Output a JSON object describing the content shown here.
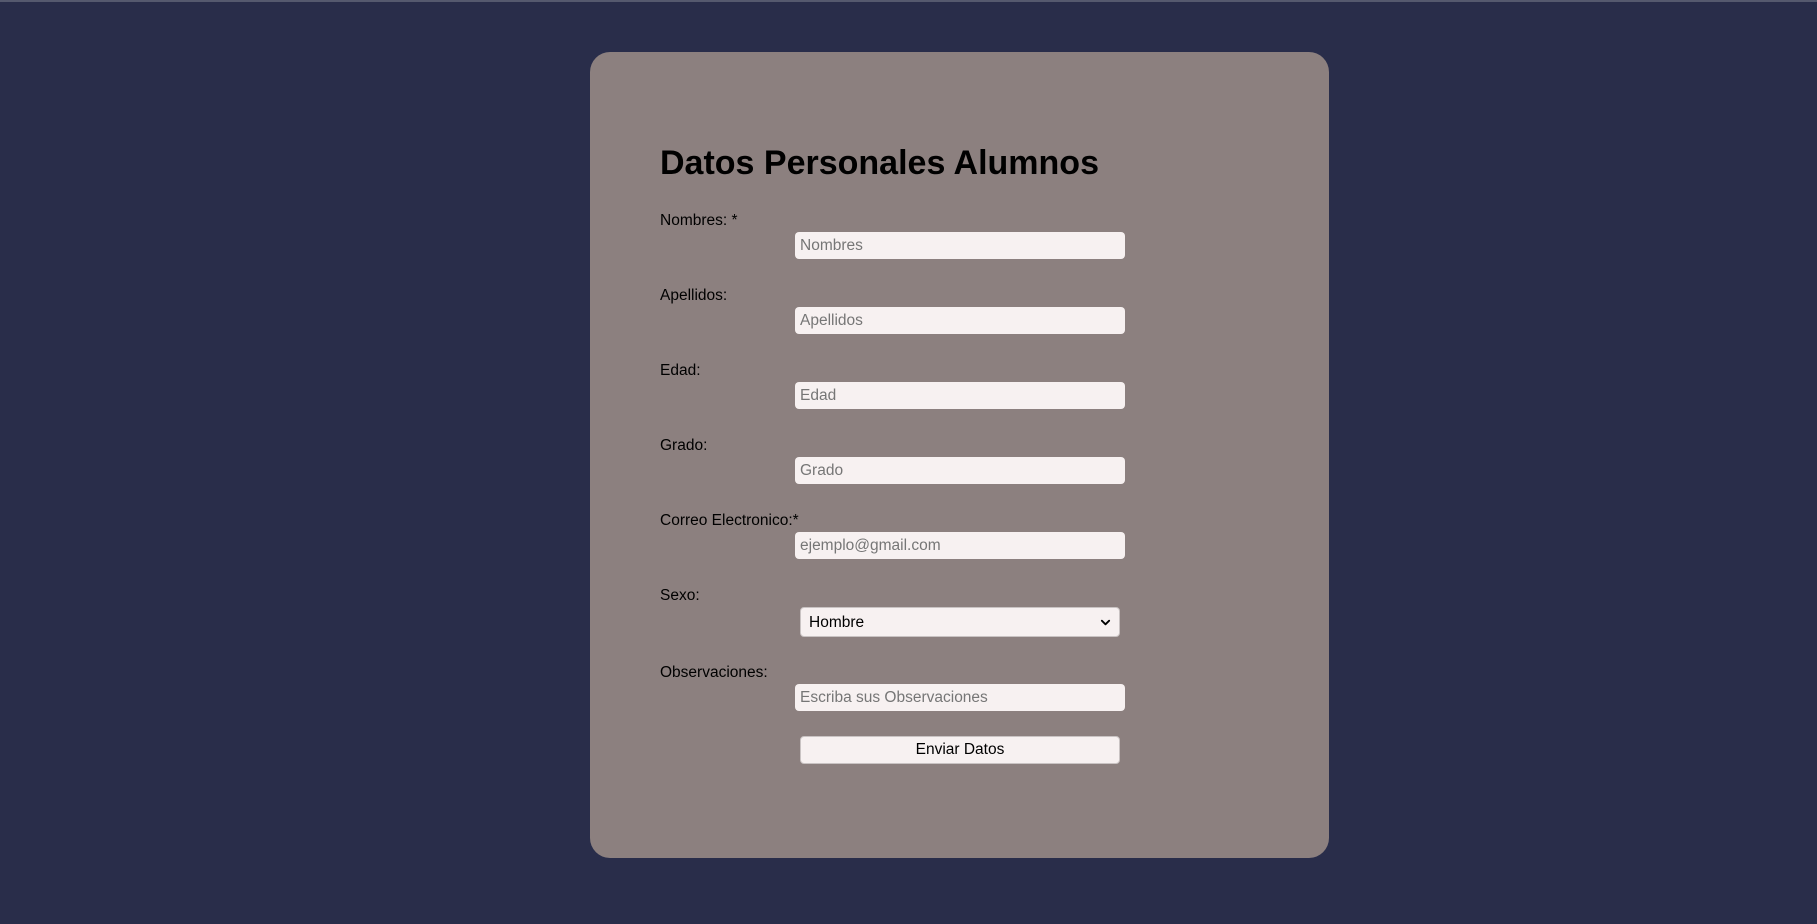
{
  "form": {
    "title": "Datos Personales Alumnos",
    "fields": [
      {
        "label": "Nombres: *",
        "placeholder": "Nombres"
      },
      {
        "label": "Apellidos:",
        "placeholder": "Apellidos"
      },
      {
        "label": "Edad:",
        "placeholder": "Edad"
      },
      {
        "label": "Grado:",
        "placeholder": "Grado"
      },
      {
        "label": "Correo Electronico:*",
        "placeholder": "ejemplo@gmail.com"
      }
    ],
    "sexo": {
      "label": "Sexo:",
      "selected": "Hombre",
      "icon": "chevron-down-icon"
    },
    "observaciones": {
      "label": "Observaciones:",
      "placeholder": "Escriba sus Observaciones"
    },
    "submit_label": "Enviar Datos"
  },
  "colors": {
    "page_background": "#292d4a",
    "card_background": "#8c807f",
    "input_background": "#f7f1f1"
  }
}
